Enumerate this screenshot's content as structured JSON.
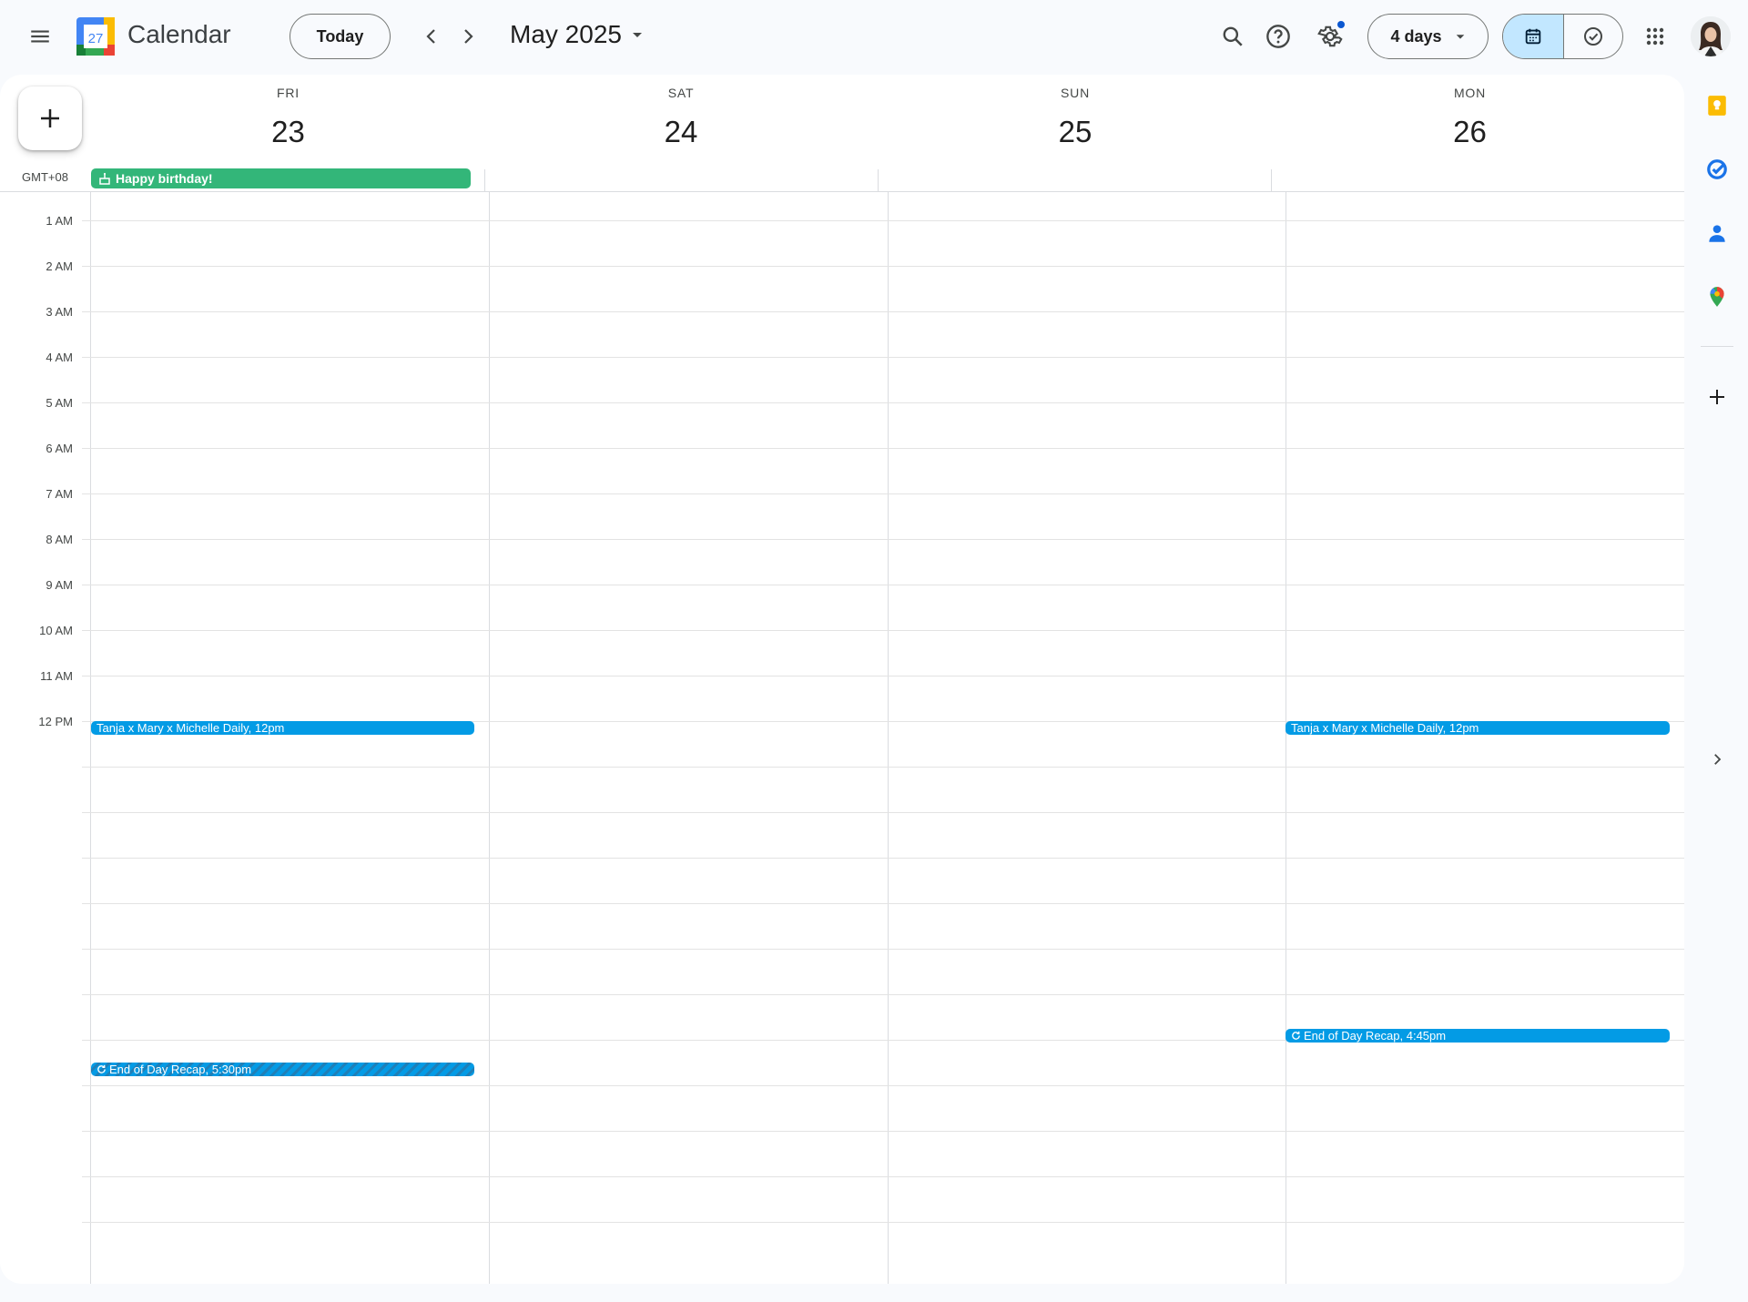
{
  "header": {
    "app_title": "Calendar",
    "logo_day": "27",
    "today_label": "Today",
    "month_title": "May 2025",
    "view_label": "4 days"
  },
  "days": [
    {
      "dow": "FRI",
      "num": "23"
    },
    {
      "dow": "SAT",
      "num": "24"
    },
    {
      "dow": "SUN",
      "num": "25"
    },
    {
      "dow": "MON",
      "num": "26"
    }
  ],
  "timezone": "GMT+08",
  "hours": [
    "1 AM",
    "2 AM",
    "3 AM",
    "4 AM",
    "5 AM",
    "6 AM",
    "7 AM",
    "8 AM",
    "9 AM",
    "10 AM",
    "11 AM",
    "12 PM"
  ],
  "all_day_event": {
    "title": "Happy birthday!",
    "color": "#33b679"
  },
  "events": [
    {
      "label": "Tanja x Mary x Michelle Daily, 12pm",
      "day": "FRI"
    },
    {
      "label": "Tanja x Mary x Michelle Daily, 12pm",
      "day": "MON"
    },
    {
      "label": "End of Day Recap, 4:45pm",
      "day": "MON",
      "recurring": true
    },
    {
      "label": "End of Day Recap, 5:30pm",
      "day": "FRI",
      "recurring": true
    }
  ],
  "colors": {
    "event_blue": "#039be5",
    "active_toggle": "#c2e7ff",
    "accent": "#0b57d0"
  },
  "icons": {
    "menu": "hamburger-menu-icon",
    "prev": "chevron-left-icon",
    "next": "chevron-right-icon",
    "search": "search-icon",
    "help": "help-icon",
    "settings": "gear-icon",
    "apps": "apps-grid-icon",
    "calendar_view": "calendar-icon",
    "tasks_view": "task-check-icon",
    "keep": "keep-icon",
    "tasks": "tasks-icon",
    "contacts": "contacts-icon",
    "maps": "maps-icon",
    "add": "plus-icon",
    "expand": "chevron-right-icon"
  }
}
